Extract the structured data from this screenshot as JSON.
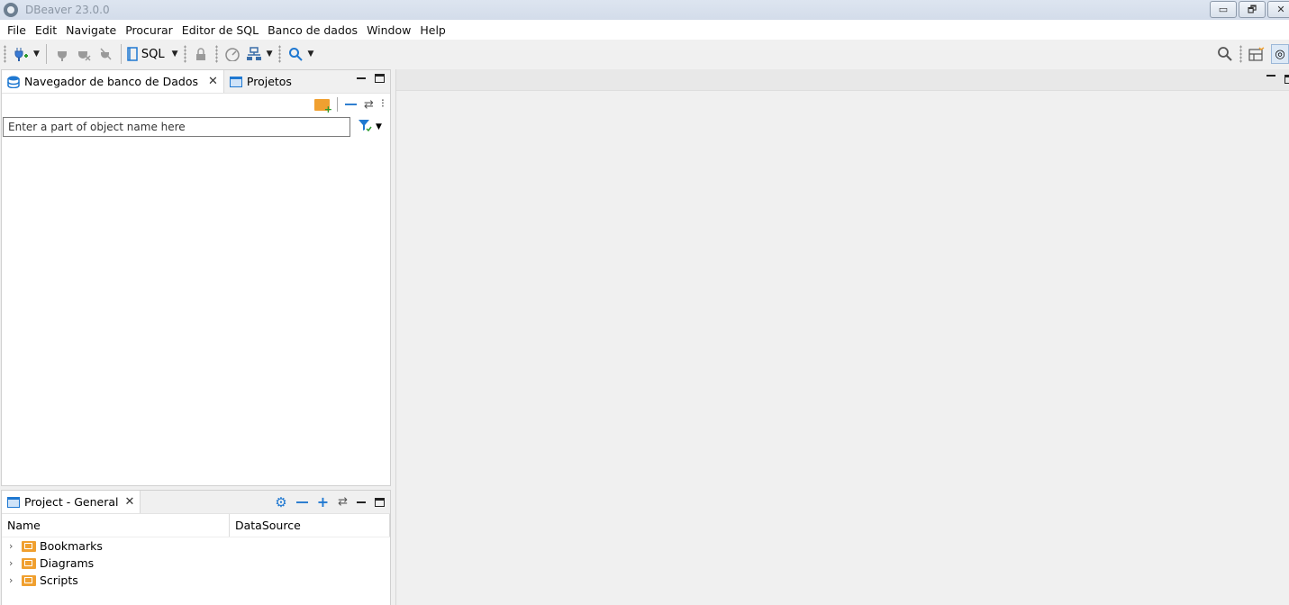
{
  "window": {
    "title": "DBeaver 23.0.0",
    "controls": {
      "minimize": "▭",
      "restore": "🗗",
      "close": "✕"
    }
  },
  "menu": [
    "File",
    "Edit",
    "Navigate",
    "Procurar",
    "Editor de SQL",
    "Banco de dados",
    "Window",
    "Help"
  ],
  "toolbar": {
    "sql_label": "SQL",
    "icons": [
      "new-connection-icon",
      "connect-icon",
      "disconnect-icon",
      "disconnect-all-icon",
      "sql-editor-icon",
      "transaction-lock-icon",
      "dashboard-icon",
      "commit-mode-icon",
      "search-icon"
    ]
  },
  "navigator": {
    "tabs": [
      {
        "label": "Navegador de banco de Dados",
        "active": true
      },
      {
        "label": "Projetos",
        "active": false
      }
    ],
    "filter_placeholder": "Enter a part of object name here"
  },
  "project": {
    "tab_label": "Project - General",
    "columns": [
      "Name",
      "DataSource"
    ],
    "items": [
      {
        "label": "Bookmarks",
        "icon": "bookmark-folder-icon"
      },
      {
        "label": "Diagrams",
        "icon": "diagram-folder-icon"
      },
      {
        "label": "Scripts",
        "icon": "script-folder-icon"
      }
    ]
  },
  "colors": {
    "accent": "#1f78d1",
    "folder": "#f0a030",
    "titlebar": "#d3dcea"
  }
}
